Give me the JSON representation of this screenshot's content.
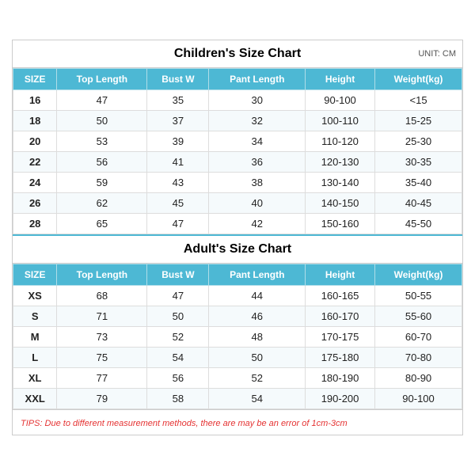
{
  "children_chart": {
    "title": "Children's Size Chart",
    "unit_label": "UNIT: CM",
    "headers": [
      "SIZE",
      "Top Length",
      "Bust W",
      "Pant Length",
      "Height",
      "Weight(kg)"
    ],
    "rows": [
      [
        "16",
        "47",
        "35",
        "30",
        "90-100",
        "<15"
      ],
      [
        "18",
        "50",
        "37",
        "32",
        "100-110",
        "15-25"
      ],
      [
        "20",
        "53",
        "39",
        "34",
        "110-120",
        "25-30"
      ],
      [
        "22",
        "56",
        "41",
        "36",
        "120-130",
        "30-35"
      ],
      [
        "24",
        "59",
        "43",
        "38",
        "130-140",
        "35-40"
      ],
      [
        "26",
        "62",
        "45",
        "40",
        "140-150",
        "40-45"
      ],
      [
        "28",
        "65",
        "47",
        "42",
        "150-160",
        "45-50"
      ]
    ]
  },
  "adult_chart": {
    "title": "Adult's Size Chart",
    "headers": [
      "SIZE",
      "Top Length",
      "Bust W",
      "Pant Length",
      "Height",
      "Weight(kg)"
    ],
    "rows": [
      [
        "XS",
        "68",
        "47",
        "44",
        "160-165",
        "50-55"
      ],
      [
        "S",
        "71",
        "50",
        "46",
        "160-170",
        "55-60"
      ],
      [
        "M",
        "73",
        "52",
        "48",
        "170-175",
        "60-70"
      ],
      [
        "L",
        "75",
        "54",
        "50",
        "175-180",
        "70-80"
      ],
      [
        "XL",
        "77",
        "56",
        "52",
        "180-190",
        "80-90"
      ],
      [
        "XXL",
        "79",
        "58",
        "54",
        "190-200",
        "90-100"
      ]
    ]
  },
  "tips": "TIPS: Due to different measurement methods, there are may be an error of 1cm-3cm"
}
